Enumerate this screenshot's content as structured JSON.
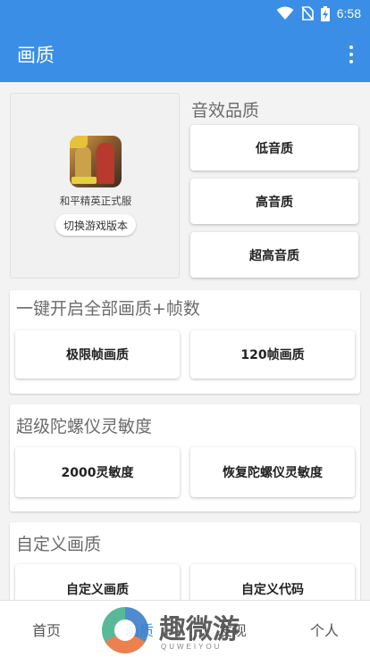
{
  "status_bar": {
    "time": "6:58",
    "icons": [
      "wifi-icon",
      "no-sim-icon",
      "battery-charging-icon"
    ]
  },
  "app_bar": {
    "title": "画质",
    "menu_icon": "more-vert-icon"
  },
  "game": {
    "name": "和平精英正式服",
    "switch_label": "切换游戏版本"
  },
  "sound": {
    "title": "音效品质",
    "buttons": [
      "低音质",
      "高音质",
      "超高音质"
    ]
  },
  "one_key": {
    "title": "一键开启全部画质+帧数",
    "buttons": [
      "极限帧画质",
      "120帧画质"
    ]
  },
  "gyro": {
    "title": "超级陀螺仪灵敏度",
    "buttons": [
      "2000灵敏度",
      "恢复陀螺仪灵敏度"
    ]
  },
  "custom": {
    "title": "自定义画质",
    "buttons": [
      "自定义画质",
      "自定义代码"
    ]
  },
  "bottom_nav": {
    "items": [
      "首页",
      "画质",
      "发现",
      "个人"
    ],
    "active_index": 1
  },
  "watermark": {
    "text": "趣微游",
    "sub": "QUWEIYOU"
  },
  "colors": {
    "primary": "#3a8ee6",
    "background": "#f3f3f3",
    "card": "#ffffff"
  }
}
